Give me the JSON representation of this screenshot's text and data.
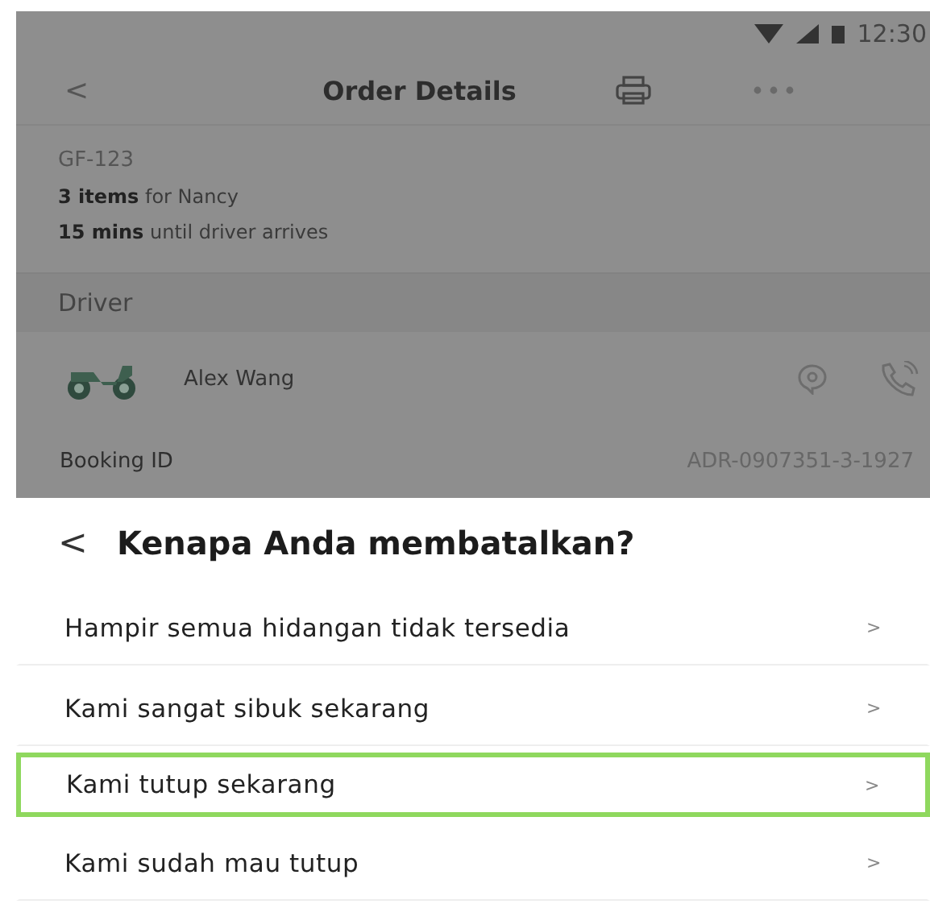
{
  "status_bar": {
    "time": "12:30"
  },
  "header": {
    "back": "<",
    "title": "Order Details"
  },
  "order": {
    "code": "GF-123",
    "items_line": "**3 items** for Nancy",
    "eta_line": "**15 mins** until driver arrives"
  },
  "driver_section": {
    "title": "Driver",
    "name": "Alex Wang"
  },
  "booking": {
    "label": "Booking ID",
    "value": "ADR-0907351-3-1927"
  },
  "sheet": {
    "back": "<",
    "title": "Kenapa Anda membatalkan?",
    "reasons": [
      {
        "label": "Hampir semua hidangan tidak tersedia",
        "chevron": ">",
        "selected": false
      },
      {
        "label": "Kami sangat sibuk sekarang",
        "chevron": ">",
        "selected": false
      },
      {
        "label": "Kami tutup sekarang",
        "chevron": ">",
        "selected": true
      },
      {
        "label": "Kami sudah mau tutup",
        "chevron": ">",
        "selected": false
      }
    ]
  }
}
